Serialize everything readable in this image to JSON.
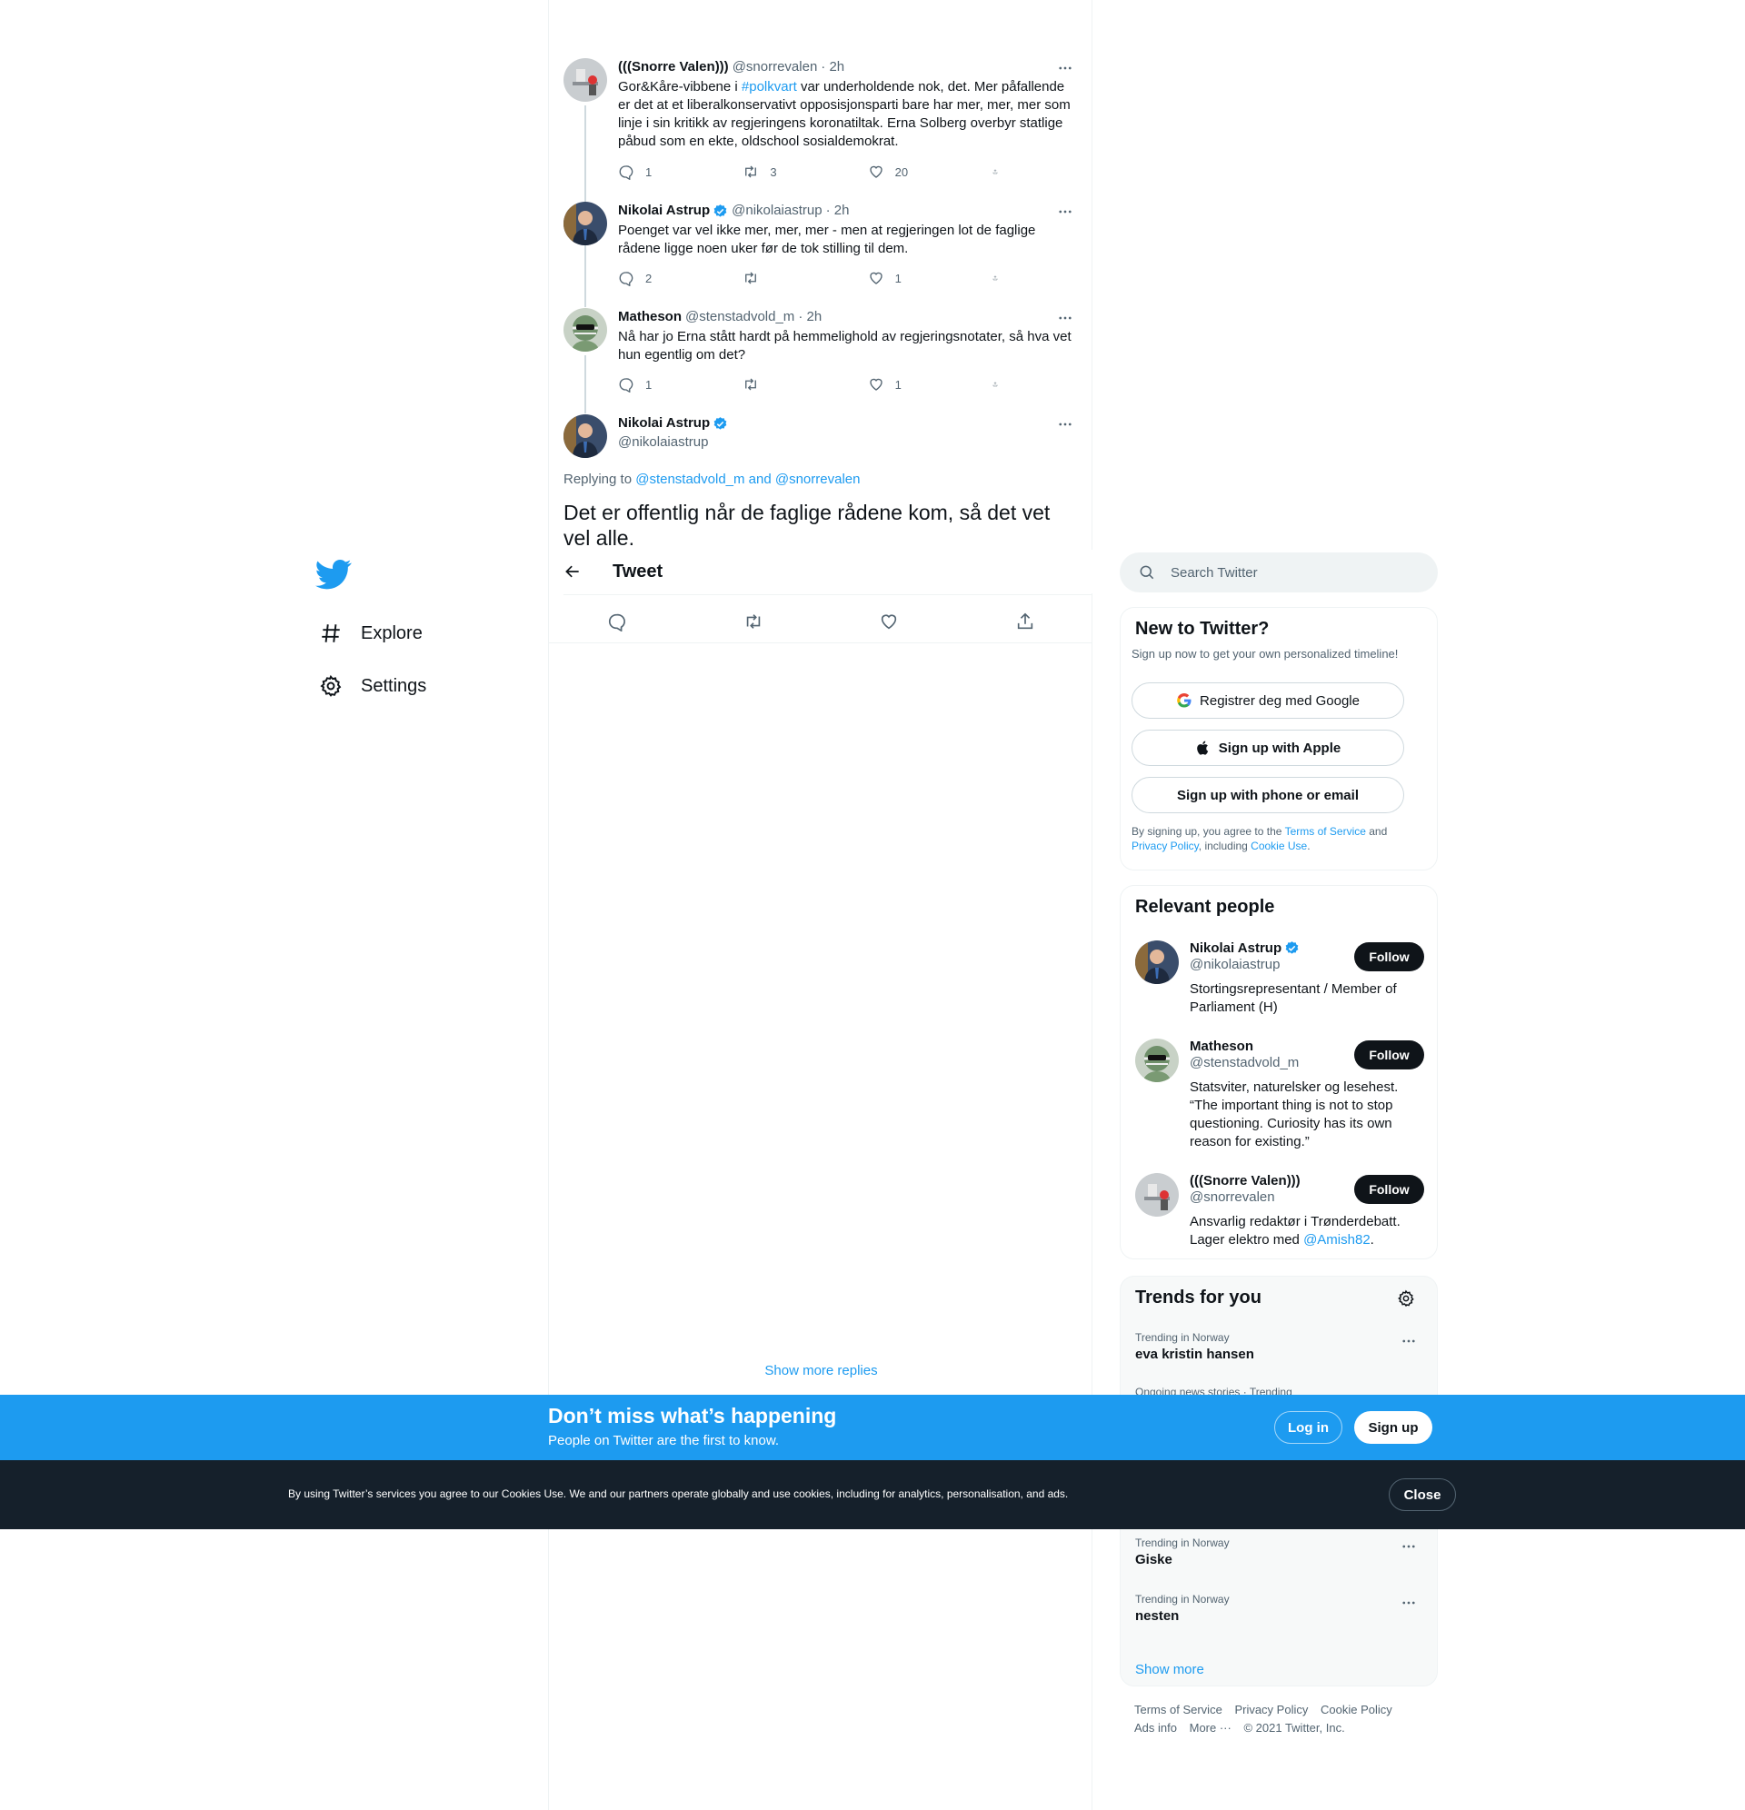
{
  "nav": {
    "items": [
      {
        "label": "Explore",
        "icon": "hashtag-icon"
      },
      {
        "label": "Settings",
        "icon": "gear-icon"
      }
    ]
  },
  "thread": [
    {
      "name": "(((Snorre Valen)))",
      "handle": "@snorrevalen",
      "time": "· 2h",
      "verified": false,
      "text_parts": [
        "Gor&Kåre-vibbene i ",
        "#polkvart",
        " var underholdende nok, det. Mer påfallende er det at et liberalkonservativt opposisjonsparti bare har mer, mer, mer som linje i sin kritikk av regjeringens koronatiltak. Erna Solberg overbyr  statlige påbud som en ekte, oldschool sosialdemokrat."
      ],
      "replies": "1",
      "retweets": "3",
      "likes": "20"
    },
    {
      "name": "Nikolai Astrup",
      "handle": "@nikolaiastrup",
      "time": "· 2h",
      "verified": true,
      "text": "Poenget var vel ikke mer, mer, mer - men at regjeringen lot de faglige rådene ligge noen uker før de tok stilling til dem.",
      "replies": "2",
      "retweets": "",
      "likes": "1"
    },
    {
      "name": "Matheson",
      "handle": "@stenstadvold_m",
      "time": "· 2h",
      "verified": false,
      "text": "Nå har jo Erna stått hardt på hemmelighold av regjeringsnotater, så hva vet hun egentlig om det?",
      "replies": "1",
      "retweets": "",
      "likes": "1"
    }
  ],
  "main_tweet": {
    "name": "Nikolai Astrup",
    "handle": "@nikolaiastrup",
    "replying_prefix": "Replying to ",
    "replying_to": "@stenstadvold_m and @snorrevalen",
    "text": "Det er offentlig når de faglige rådene kom, så det vet vel alle."
  },
  "header": {
    "title": "Tweet"
  },
  "show_more_replies": "Show more replies",
  "search": {
    "placeholder": "Search Twitter"
  },
  "signup": {
    "title": "New to Twitter?",
    "subtitle": "Sign up now to get your own personalized timeline!",
    "google": "Registrer deg med Google",
    "apple": "Sign up with Apple",
    "phone": "Sign up with phone or email",
    "legal_1": "By signing up, you agree to the ",
    "terms": "Terms of Service",
    "legal_2": " and ",
    "privacy": "Privacy Policy",
    "legal_3": ", including ",
    "cookie": "Cookie Use",
    "legal_4": "."
  },
  "people": {
    "title": "Relevant people",
    "follow_label": "Follow",
    "items": [
      {
        "name": "Nikolai Astrup",
        "handle": "@nikolaiastrup",
        "bio": "Stortingsrepresentant / Member of Parliament (H)"
      },
      {
        "name": "Matheson",
        "handle": "@stenstadvold_m",
        "bio": "Statsviter, naturelsker og lesehest. “The important thing is not to stop questioning. Curiosity has its own reason for existing.”"
      },
      {
        "name": "(((Snorre Valen)))",
        "handle": "@snorrevalen",
        "bio_1": "Ansvarlig redaktør i Trønderdebatt. Lager elektro med ",
        "bio_link": "@Amish82",
        "bio_2": "."
      }
    ]
  },
  "trends": {
    "title": "Trends for you",
    "items": [
      {
        "context": "Trending in Norway",
        "name": "eva kristin hansen"
      },
      {
        "context": "Ongoing news stories · Trending",
        "name": ""
      },
      {
        "context": "Trending in Norway",
        "name": "Giske"
      },
      {
        "context": "Trending in Norway",
        "name": "nesten"
      }
    ],
    "show_more": "Show more"
  },
  "footer": {
    "links": [
      "Terms of Service",
      "Privacy Policy",
      "Cookie Policy",
      "Ads info",
      "More ···",
      "© 2021 Twitter, Inc."
    ]
  },
  "bluebar": {
    "title": "Don’t miss what’s happening",
    "subtitle": "People on Twitter are the first to know.",
    "login": "Log in",
    "signup": "Sign up"
  },
  "cookiebar": {
    "text": "By using Twitter’s services you agree to our Cookies Use. We and our partners operate globally and use cookies, including for analytics, personalisation, and ads.",
    "close": "Close"
  },
  "colors": {
    "accent": "#1d9bf0",
    "text": "#0f1419",
    "muted": "#536471",
    "cookiebar": "#15202b"
  }
}
